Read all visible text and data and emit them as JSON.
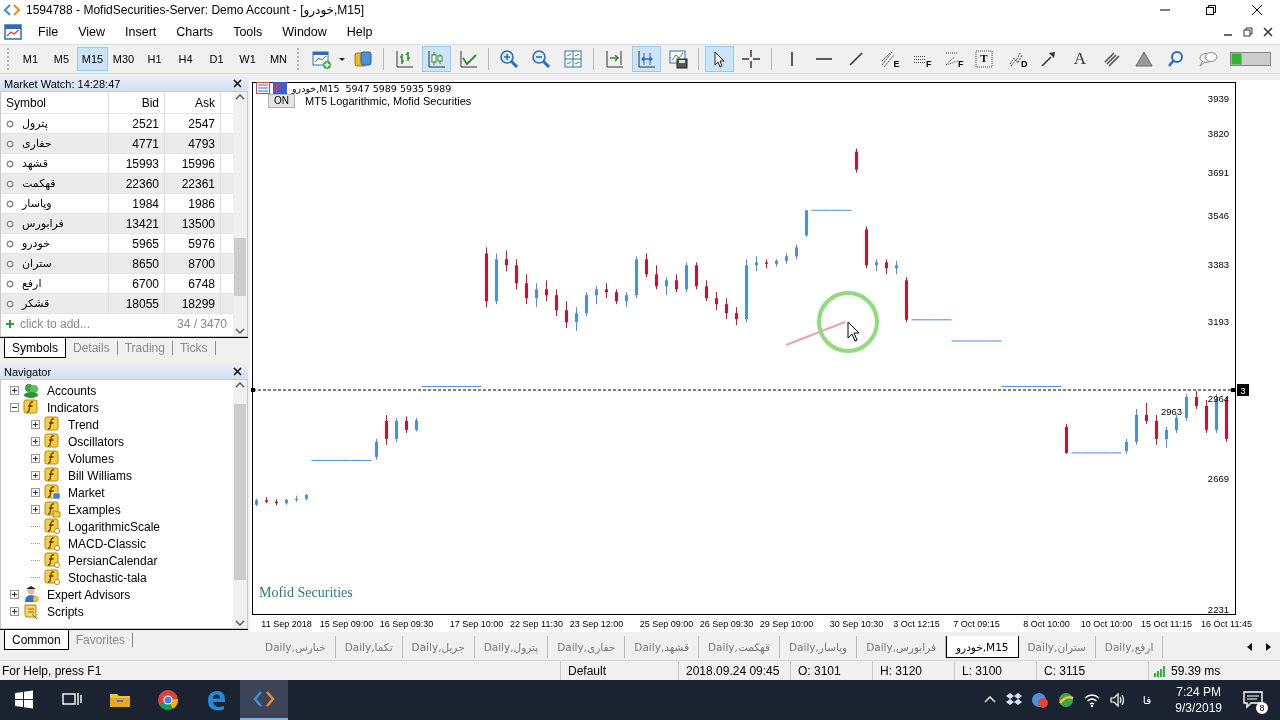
{
  "window": {
    "title": "1594788 - MofidSecurities-Server: Demo Account - [خودرو,M15]"
  },
  "menu": [
    "File",
    "View",
    "Insert",
    "Charts",
    "Tools",
    "Window",
    "Help"
  ],
  "timeframes": [
    {
      "label": "M1",
      "selected": false
    },
    {
      "label": "M5",
      "selected": false
    },
    {
      "label": "M15",
      "selected": true
    },
    {
      "label": "M30",
      "selected": false
    },
    {
      "label": "H1",
      "selected": false
    },
    {
      "label": "H4",
      "selected": false
    },
    {
      "label": "D1",
      "selected": false
    },
    {
      "label": "W1",
      "selected": false
    },
    {
      "label": "MN",
      "selected": false
    }
  ],
  "toolbar": [
    {
      "kind": "new-chart",
      "selected": false
    },
    {
      "kind": "market",
      "selected": false
    },
    {
      "kind": "bars",
      "selected": false
    },
    {
      "kind": "candles",
      "selected": true
    },
    {
      "kind": "line",
      "selected": false
    },
    {
      "kind": "zoom-in",
      "selected": false
    },
    {
      "kind": "zoom-out",
      "selected": false
    },
    {
      "kind": "tile",
      "selected": false
    },
    {
      "kind": "shift",
      "selected": false
    },
    {
      "kind": "autoscroll",
      "selected": true
    },
    {
      "kind": "template",
      "selected": false
    },
    {
      "kind": "cursor",
      "selected": true
    },
    {
      "kind": "crosshair",
      "selected": false
    },
    {
      "kind": "vline",
      "selected": false
    },
    {
      "kind": "hline",
      "selected": false
    },
    {
      "kind": "trend",
      "selected": false
    },
    {
      "kind": "fibo",
      "selected": false,
      "badge": "E"
    },
    {
      "kind": "fibo-grid",
      "selected": false,
      "badge": "F"
    },
    {
      "kind": "fibo-fan",
      "selected": false,
      "badge": "F"
    },
    {
      "kind": "text-box",
      "selected": false,
      "badge": "T"
    },
    {
      "kind": "wave",
      "selected": false,
      "badge": "D"
    },
    {
      "kind": "arrow",
      "selected": false
    },
    {
      "kind": "text",
      "selected": false,
      "label": "A"
    },
    {
      "kind": "channel",
      "selected": false
    },
    {
      "kind": "shapes",
      "selected": false
    },
    {
      "kind": "search",
      "selected": false
    },
    {
      "kind": "chat",
      "selected": false
    }
  ],
  "market_watch": {
    "title": "Market Watch: 14:28:47",
    "columns": [
      "Symbol",
      "Bid",
      "Ask"
    ],
    "rows": [
      {
        "symbol": "پترول",
        "bid": "2521",
        "ask": "2547"
      },
      {
        "symbol": "حفاری",
        "bid": "4771",
        "ask": "4793"
      },
      {
        "symbol": "قشهد",
        "bid": "15993",
        "ask": "15996"
      },
      {
        "symbol": "قهکمت",
        "bid": "22360",
        "ask": "22361"
      },
      {
        "symbol": "وپاسار",
        "bid": "1984",
        "ask": "1986"
      },
      {
        "symbol": "فرابورس",
        "bid": "13421",
        "ask": "13500"
      },
      {
        "symbol": "خودرو",
        "bid": "5965",
        "ask": "5976"
      },
      {
        "symbol": "ستران",
        "bid": "8650",
        "ask": "8700"
      },
      {
        "symbol": "ارفع",
        "bid": "6700",
        "ask": "6748"
      },
      {
        "symbol": "قشکر",
        "bid": "18055",
        "ask": "18299"
      }
    ],
    "add_hint": "click to add...",
    "count": "34 / 3470",
    "tabs": [
      {
        "label": "Symbols",
        "selected": true
      },
      {
        "label": "Details",
        "selected": false
      },
      {
        "label": "Trading",
        "selected": false
      },
      {
        "label": "Ticks",
        "selected": false
      }
    ]
  },
  "navigator": {
    "title": "Navigator",
    "tree": [
      {
        "label": "Accounts",
        "kind": "accounts",
        "expanded": false
      },
      {
        "label": "Indicators",
        "kind": "group",
        "expanded": true,
        "children": [
          {
            "label": "Trend",
            "kind": "group",
            "expanded": false
          },
          {
            "label": "Oscillators",
            "kind": "group",
            "expanded": false
          },
          {
            "label": "Volumes",
            "kind": "group",
            "expanded": false
          },
          {
            "label": "Bill Williams",
            "kind": "group",
            "expanded": false
          },
          {
            "label": "Market",
            "kind": "market",
            "expanded": false
          },
          {
            "label": "Examples",
            "kind": "folder",
            "expanded": false
          },
          {
            "label": "LogarithmicScale",
            "kind": "indicator"
          },
          {
            "label": "MACD-Classic",
            "kind": "indicator"
          },
          {
            "label": "PersianCalendar",
            "kind": "indicator"
          },
          {
            "label": "Stochastic-tala",
            "kind": "indicator"
          }
        ]
      },
      {
        "label": "Expert Advisors",
        "kind": "experts",
        "expanded": false
      },
      {
        "label": "Scripts",
        "kind": "scripts",
        "expanded": false
      }
    ],
    "tabs": [
      {
        "label": "Common",
        "selected": true
      },
      {
        "label": "Favorites",
        "selected": false
      }
    ]
  },
  "chart": {
    "header": "خودرو,M15  5947 5989 5935 5989",
    "indicator_toggle": "ON",
    "indicator_name": "MT5 Logarithmic, Mofid Securities",
    "watermark": "Mofid Securities",
    "current_price": "2964",
    "price_tag": "2963",
    "line_marker": "3",
    "chart_data": {
      "type": "candlestick",
      "ylim": [
        2213,
        3991
      ],
      "yticks": [
        3939,
        3820,
        3691,
        3546,
        3383,
        3193,
        2669,
        2231
      ],
      "categories": [
        null,
        null,
        null,
        "11 Sep 2018",
        null,
        null,
        null,
        null,
        null,
        "15 Sep 09:00",
        null,
        null,
        null,
        null,
        null,
        "16 Sep 09:30",
        null,
        null,
        null,
        null,
        null,
        null,
        "17 Sep 10:00",
        null,
        null,
        null,
        null,
        null,
        "22 Sep 11:30",
        null,
        null,
        null,
        null,
        null,
        "23 Sep 12:00",
        null,
        null,
        null,
        null,
        null,
        null,
        "25 Sep 09:00",
        null,
        null,
        null,
        null,
        null,
        "26 Sep 09:30",
        null,
        null,
        null,
        null,
        null,
        "29 Sep 10:00",
        null,
        null,
        null,
        null,
        null,
        null,
        "30 Sep 10:30",
        null,
        null,
        null,
        null,
        null,
        "3 Oct 12:15",
        null,
        null,
        null,
        null,
        null,
        "7 Oct 09:15",
        null,
        null,
        null,
        null,
        null,
        null,
        "8 Oct 10:00",
        null,
        null,
        null,
        null,
        null,
        "10 Oct 10:00",
        null,
        null,
        null,
        null,
        null,
        "15 Oct 11:15",
        null,
        null,
        null,
        null,
        null,
        "16 Oct 11:45"
      ],
      "ohlc": [
        [
          2580,
          2600,
          2575,
          2595
        ],
        [
          2595,
          2605,
          2585,
          2590
        ],
        [
          2590,
          2598,
          2578,
          2585
        ],
        [
          2585,
          2600,
          2580,
          2596
        ],
        [
          2596,
          2610,
          2590,
          2600
        ],
        [
          2600,
          2615,
          2595,
          2612
        ],
        [
          2728,
          2728,
          2728,
          2728
        ],
        [
          2728,
          2728,
          2728,
          2728
        ],
        [
          2728,
          2728,
          2728,
          2728
        ],
        [
          2728,
          2728,
          2728,
          2728
        ],
        [
          2728,
          2728,
          2728,
          2728
        ],
        [
          2728,
          2728,
          2728,
          2728
        ],
        [
          2740,
          2800,
          2730,
          2790
        ],
        [
          2860,
          2880,
          2780,
          2800
        ],
        [
          2800,
          2870,
          2790,
          2860
        ],
        [
          2860,
          2875,
          2820,
          2830
        ],
        [
          2830,
          2870,
          2825,
          2862
        ],
        [
          2975,
          2975,
          2975,
          2975
        ],
        [
          2975,
          2975,
          2975,
          2975
        ],
        [
          2975,
          2975,
          2975,
          2975
        ],
        [
          2975,
          2975,
          2975,
          2975
        ],
        [
          2975,
          2975,
          2975,
          2975
        ],
        [
          2975,
          2975,
          2975,
          2975
        ],
        [
          3420,
          3440,
          3240,
          3260
        ],
        [
          3260,
          3420,
          3250,
          3400
        ],
        [
          3400,
          3430,
          3360,
          3380
        ],
        [
          3380,
          3400,
          3300,
          3320
        ],
        [
          3320,
          3350,
          3250,
          3270
        ],
        [
          3270,
          3320,
          3240,
          3300
        ],
        [
          3300,
          3330,
          3260,
          3280
        ],
        [
          3280,
          3300,
          3210,
          3230
        ],
        [
          3230,
          3260,
          3170,
          3190
        ],
        [
          3190,
          3240,
          3160,
          3220
        ],
        [
          3220,
          3290,
          3210,
          3280
        ],
        [
          3280,
          3310,
          3250,
          3300
        ],
        [
          3300,
          3320,
          3270,
          3290
        ],
        [
          3290,
          3300,
          3250,
          3260
        ],
        [
          3260,
          3290,
          3240,
          3280
        ],
        [
          3280,
          3410,
          3270,
          3400
        ],
        [
          3400,
          3420,
          3340,
          3350
        ],
        [
          3350,
          3380,
          3300,
          3310
        ],
        [
          3310,
          3340,
          3280,
          3330
        ],
        [
          3330,
          3350,
          3290,
          3300
        ],
        [
          3300,
          3390,
          3290,
          3380
        ],
        [
          3380,
          3390,
          3300,
          3310
        ],
        [
          3310,
          3330,
          3260,
          3270
        ],
        [
          3270,
          3290,
          3230,
          3250
        ],
        [
          3250,
          3270,
          3200,
          3220
        ],
        [
          3220,
          3240,
          3180,
          3200
        ],
        [
          3200,
          3400,
          3190,
          3380
        ],
        [
          3380,
          3410,
          3360,
          3390
        ],
        [
          3390,
          3400,
          3370,
          3385
        ],
        [
          3385,
          3400,
          3375,
          3395
        ],
        [
          3395,
          3420,
          3385,
          3410
        ],
        [
          3410,
          3450,
          3400,
          3440
        ],
        [
          3480,
          3564,
          3475,
          3564
        ],
        [
          3564,
          3564,
          3564,
          3564
        ],
        [
          3564,
          3564,
          3564,
          3564
        ],
        [
          3564,
          3564,
          3564,
          3564
        ],
        [
          3564,
          3564,
          3564,
          3564
        ],
        [
          3760,
          3770,
          3690,
          3700
        ],
        [
          3500,
          3510,
          3370,
          3380
        ],
        [
          3380,
          3400,
          3360,
          3390
        ],
        [
          3390,
          3400,
          3350,
          3370
        ],
        [
          3370,
          3395,
          3350,
          3380
        ],
        [
          3330,
          3340,
          3190,
          3198
        ],
        [
          3198,
          3198,
          3198,
          3198
        ],
        [
          3198,
          3198,
          3198,
          3198
        ],
        [
          3198,
          3198,
          3198,
          3198
        ],
        [
          3198,
          3198,
          3198,
          3198
        ],
        [
          3127,
          3127,
          3127,
          3127
        ],
        [
          3127,
          3127,
          3127,
          3127
        ],
        [
          3127,
          3127,
          3127,
          3127
        ],
        [
          3127,
          3127,
          3127,
          3127
        ],
        [
          3127,
          3127,
          3127,
          3127
        ],
        [
          2975,
          2975,
          2975,
          2975
        ],
        [
          2975,
          2975,
          2975,
          2975
        ],
        [
          2975,
          2975,
          2975,
          2975
        ],
        [
          2975,
          2975,
          2975,
          2975
        ],
        [
          2975,
          2975,
          2975,
          2975
        ],
        [
          2975,
          2975,
          2975,
          2975
        ],
        [
          2840,
          2850,
          2750,
          2753
        ],
        [
          2753,
          2753,
          2753,
          2753
        ],
        [
          2753,
          2753,
          2753,
          2753
        ],
        [
          2753,
          2753,
          2753,
          2753
        ],
        [
          2753,
          2753,
          2753,
          2753
        ],
        [
          2753,
          2753,
          2753,
          2753
        ],
        [
          2760,
          2800,
          2750,
          2790
        ],
        [
          2790,
          2900,
          2780,
          2880
        ],
        [
          2880,
          2920,
          2850,
          2860
        ],
        [
          2860,
          2880,
          2780,
          2800
        ],
        [
          2800,
          2840,
          2770,
          2830
        ],
        [
          2830,
          2880,
          2820,
          2870
        ],
        [
          2870,
          2950,
          2860,
          2940
        ],
        [
          2940,
          2960,
          2900,
          2910
        ],
        [
          2910,
          2930,
          2820,
          2830
        ],
        [
          2830,
          2950,
          2820,
          2930
        ],
        [
          2930,
          2940,
          2790,
          2800
        ]
      ]
    },
    "tabs": [
      {
        "label": "Daily,خبارس",
        "selected": false
      },
      {
        "label": "Daily,تکما",
        "selected": false
      },
      {
        "label": "Daily,جریل",
        "selected": false
      },
      {
        "label": "Daily,پترول",
        "selected": false
      },
      {
        "label": "Daily,حفاری",
        "selected": false
      },
      {
        "label": "Daily,قشهد",
        "selected": false
      },
      {
        "label": "Daily,قهکمت",
        "selected": false
      },
      {
        "label": "Daily,وپاسار",
        "selected": false
      },
      {
        "label": "Daily,فرابورس",
        "selected": false
      },
      {
        "label": "خودرو,M15",
        "selected": true
      },
      {
        "label": "Daily,ستران",
        "selected": false
      },
      {
        "label": "Daily,ارفع",
        "selected": false
      }
    ]
  },
  "status_bar": {
    "help": "For Help, press F1",
    "profile": "Default",
    "time": "2018.09.24 09:45",
    "open": "O: 3101",
    "high": "H: 3120",
    "low": "L: 3100",
    "close": "C: 3115",
    "ping": "59.39 ms"
  },
  "taskbar": {
    "language": "فا",
    "time": "7:24 PM",
    "date": "9/3/2019",
    "notifications": "8"
  }
}
